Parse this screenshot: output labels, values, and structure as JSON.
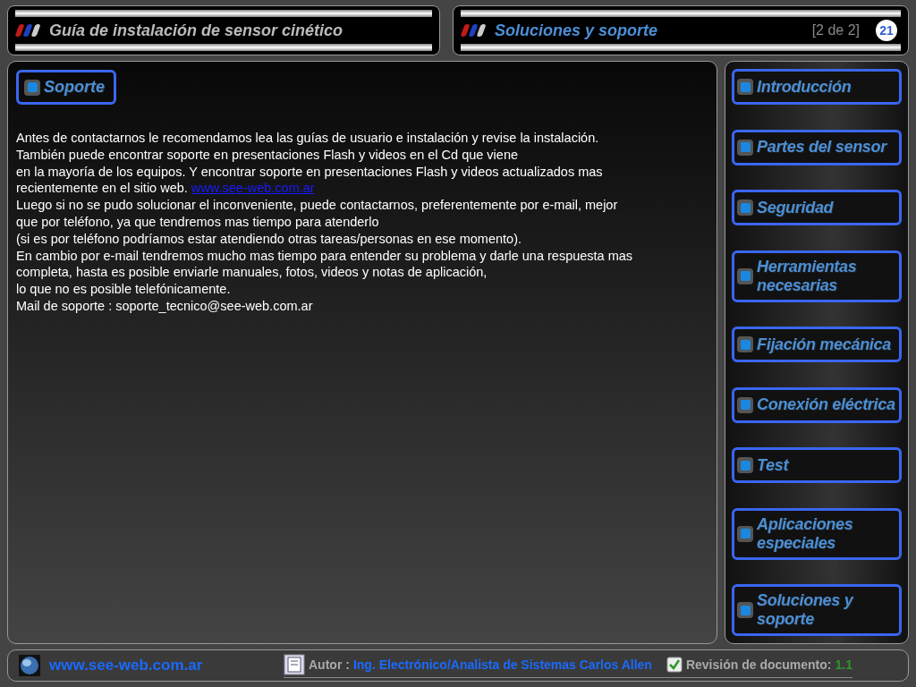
{
  "header": {
    "guide_title": "Guía de instalación de sensor cinético",
    "section_title": "Soluciones y soporte",
    "page_info": "[2 de 2]",
    "page_number": "21"
  },
  "content": {
    "heading": "Soporte",
    "lines": [
      {
        "text": "Antes de contactarnos le recomendamos lea las guías de usuario e instalación y revise la instalación."
      },
      {
        "text": "También puede encontrar soporte en presentaciones Flash y videos en el Cd que viene"
      },
      {
        "text": "en la mayoría de los equipos. Y  encontrar soporte en presentaciones Flash y videos actualizados mas"
      },
      {
        "text": "recientemente en el sitio web. ",
        "link": "www.see-web.com.ar"
      },
      {
        "text": "Luego si no se pudo solucionar el inconveniente, puede contactarnos, preferentemente por e-mail, mejor"
      },
      {
        "text": "que por teléfono, ya que tendremos mas tiempo para atenderlo"
      },
      {
        "text": "(si es por teléfono podríamos estar atendiendo otras tareas/personas en ese momento)."
      },
      {
        "text": "En cambio por e-mail tendremos mucho mas tiempo para entender su problema y darle una respuesta mas"
      },
      {
        "text": "completa, hasta es posible enviarle manuales, fotos, videos y notas de aplicación,"
      },
      {
        "text": "lo que no es posible telefónicamente."
      },
      {
        "text": "Mail de soporte : soporte_tecnico@see-web.com.ar"
      }
    ]
  },
  "sidebar": {
    "items": [
      {
        "label": "Introducción"
      },
      {
        "label": "Partes del sensor"
      },
      {
        "label": "Seguridad"
      },
      {
        "label": "Herramientas necesarias"
      },
      {
        "label": "Fijación mecánica"
      },
      {
        "label": "Conexión eléctrica"
      },
      {
        "label": "Test"
      },
      {
        "label": "Aplicaciones especiales"
      },
      {
        "label": "Soluciones y soporte"
      }
    ]
  },
  "footer": {
    "website": "www.see-web.com.ar",
    "author_label": "Autor :",
    "author": "Ing. Electrónico/Analista de Sistemas Carlos Allen",
    "revision_label": "Revisión de documento:",
    "revision": "1.1"
  }
}
